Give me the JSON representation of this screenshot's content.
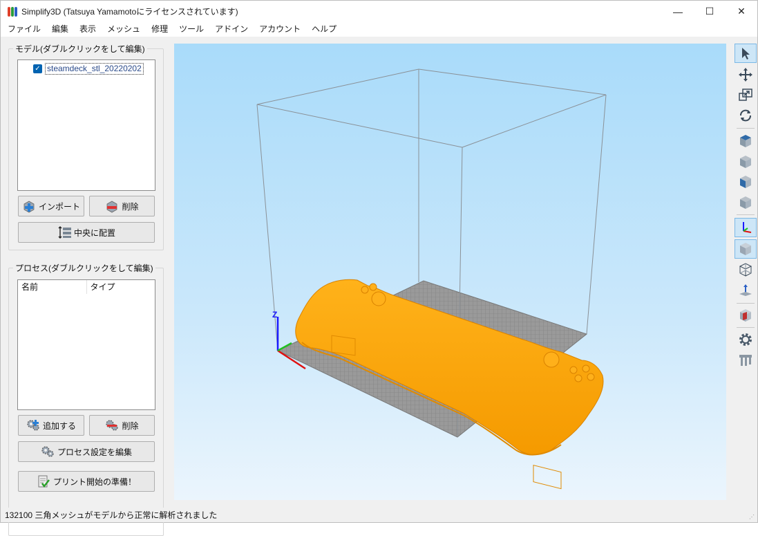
{
  "window": {
    "title": "Simplify3D (Tatsuya Yamamotoにライセンスされています)",
    "minimize": "—",
    "maximize": "☐",
    "close": "✕"
  },
  "menu": [
    "ファイル",
    "編集",
    "表示",
    "メッシュ",
    "修理",
    "ツール",
    "アドイン",
    "アカウント",
    "ヘルプ"
  ],
  "models": {
    "group_title": "モデル(ダブルクリックをして編集)",
    "items": [
      {
        "name": "steamdeck_stl_20220202",
        "checked": true
      }
    ],
    "import_button": "インポート",
    "delete_button": "削除",
    "center_button": "中央に配置"
  },
  "processes": {
    "group_title": "プロセス(ダブルクリックをして編集)",
    "columns": [
      "名前",
      "タイプ"
    ],
    "add_button": "追加する",
    "delete_button": "削除",
    "edit_button": "プロセス設定を編集",
    "prepare_button": "プリント開始の準備！"
  },
  "viewport": {
    "axis_label": "Z",
    "model_color": "#ffa500",
    "background_top": "#a9dbfa",
    "background_bottom": "#ebf5fd"
  },
  "toolbar": {
    "icons": [
      "select-arrow",
      "move",
      "scale",
      "rotate",
      "view-top",
      "view-front",
      "view-side",
      "view-iso",
      "axes",
      "solid-view",
      "wireframe-view",
      "build-platform",
      "cross-section",
      "gear",
      "supports"
    ]
  },
  "status": {
    "message": "132100 三角メッシュがモデルから正常に解析されました"
  }
}
